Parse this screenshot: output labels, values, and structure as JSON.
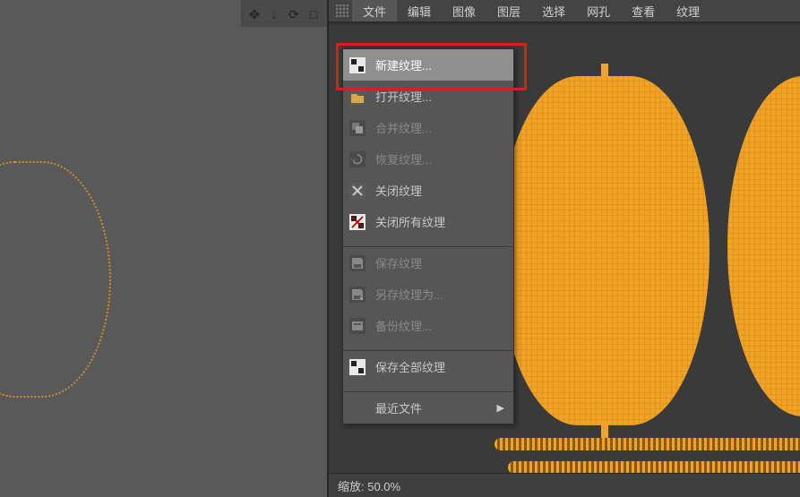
{
  "menubar": {
    "items": [
      "文件",
      "编辑",
      "图像",
      "图层",
      "选择",
      "网孔",
      "查看",
      "纹理"
    ]
  },
  "dropdown": {
    "new_texture": "新建纹理...",
    "open_texture": "打开纹理...",
    "merge_texture": "合并纹理...",
    "restore_texture": "恢复纹理...",
    "close_texture": "关闭纹理",
    "close_all_textures": "关闭所有纹理",
    "save_texture": "保存纹理",
    "save_texture_as": "另存纹理为...",
    "backup_texture": "备份纹理...",
    "save_all_textures": "保存全部纹理",
    "recent_files": "最近文件"
  },
  "statusbar": {
    "zoom_label": "缩放: 50.0%"
  },
  "left_tools": {
    "move": "✥",
    "down": "↓",
    "rotate": "⟳",
    "maximize": "□"
  },
  "colors": {
    "uv": "#f1a325",
    "highlight_box": "#d61f1f"
  }
}
